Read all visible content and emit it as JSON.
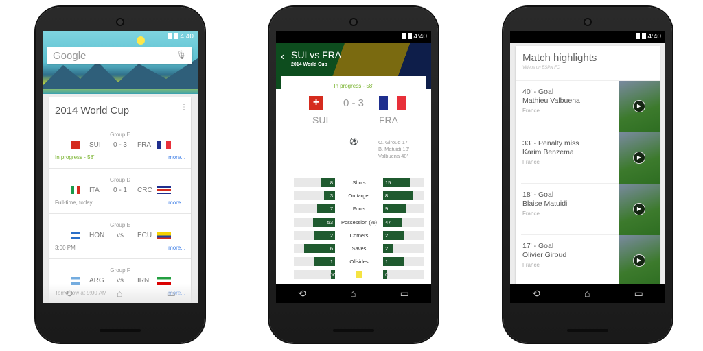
{
  "status_time": "4:40",
  "colors": {
    "accent_green": "#77b22c",
    "stat_bar": "#1f5a2f",
    "link": "#4a86e8"
  },
  "phone1": {
    "search_placeholder": "Google",
    "card_title": "2014 World Cup",
    "matches": [
      {
        "group": "Group E",
        "home": "SUI",
        "score": "0 - 3",
        "away": "FRA",
        "status": "In progress - 58'",
        "more": "more...",
        "live": true
      },
      {
        "group": "Group D",
        "home": "ITA",
        "score": "0 - 1",
        "away": "CRC",
        "status": "Full-time, today",
        "more": "more..."
      },
      {
        "group": "Group E",
        "home": "HON",
        "score": "vs",
        "away": "ECU",
        "status": "3:00 PM",
        "more": "more..."
      },
      {
        "group": "Group F",
        "home": "ARG",
        "score": "vs",
        "away": "IRN",
        "status": "Tomorrow at 9:00 AM",
        "more": "more..."
      }
    ]
  },
  "phone2": {
    "title": "SUI vs FRA",
    "subtitle": "2014 World Cup",
    "status": "In progress - 58'",
    "home": "SUI",
    "away": "FRA",
    "score": "0 - 3",
    "scorers": [
      "O. Giroud 17'",
      "B. Matuidi 18'",
      "Valbuena 40'"
    ],
    "stats": [
      {
        "label": "Shots",
        "home": 8,
        "away": 15
      },
      {
        "label": "On target",
        "home": 3,
        "away": 8
      },
      {
        "label": "Fouls",
        "home": 7,
        "away": 9
      },
      {
        "label": "Possession (%)",
        "home": 53,
        "away": 47
      },
      {
        "label": "Corners",
        "home": 2,
        "away": 2
      },
      {
        "label": "Saves",
        "home": 6,
        "away": 2
      },
      {
        "label": "Offsides",
        "home": 1,
        "away": 1
      },
      {
        "label": "",
        "home": 0,
        "away": 0,
        "icon": "yellow-card-icon"
      }
    ]
  },
  "phone3": {
    "title": "Match highlights",
    "subtitle": "Videos on ESPN FC",
    "items": [
      {
        "event": "40' - Goal",
        "player": "Mathieu Valbuena",
        "team": "France"
      },
      {
        "event": "33' - Penalty miss",
        "player": "Karim Benzema",
        "team": "France"
      },
      {
        "event": "18' - Goal",
        "player": "Blaise Matuidi",
        "team": "France"
      },
      {
        "event": "17' - Goal",
        "player": "Olivier Giroud",
        "team": "France"
      }
    ]
  }
}
